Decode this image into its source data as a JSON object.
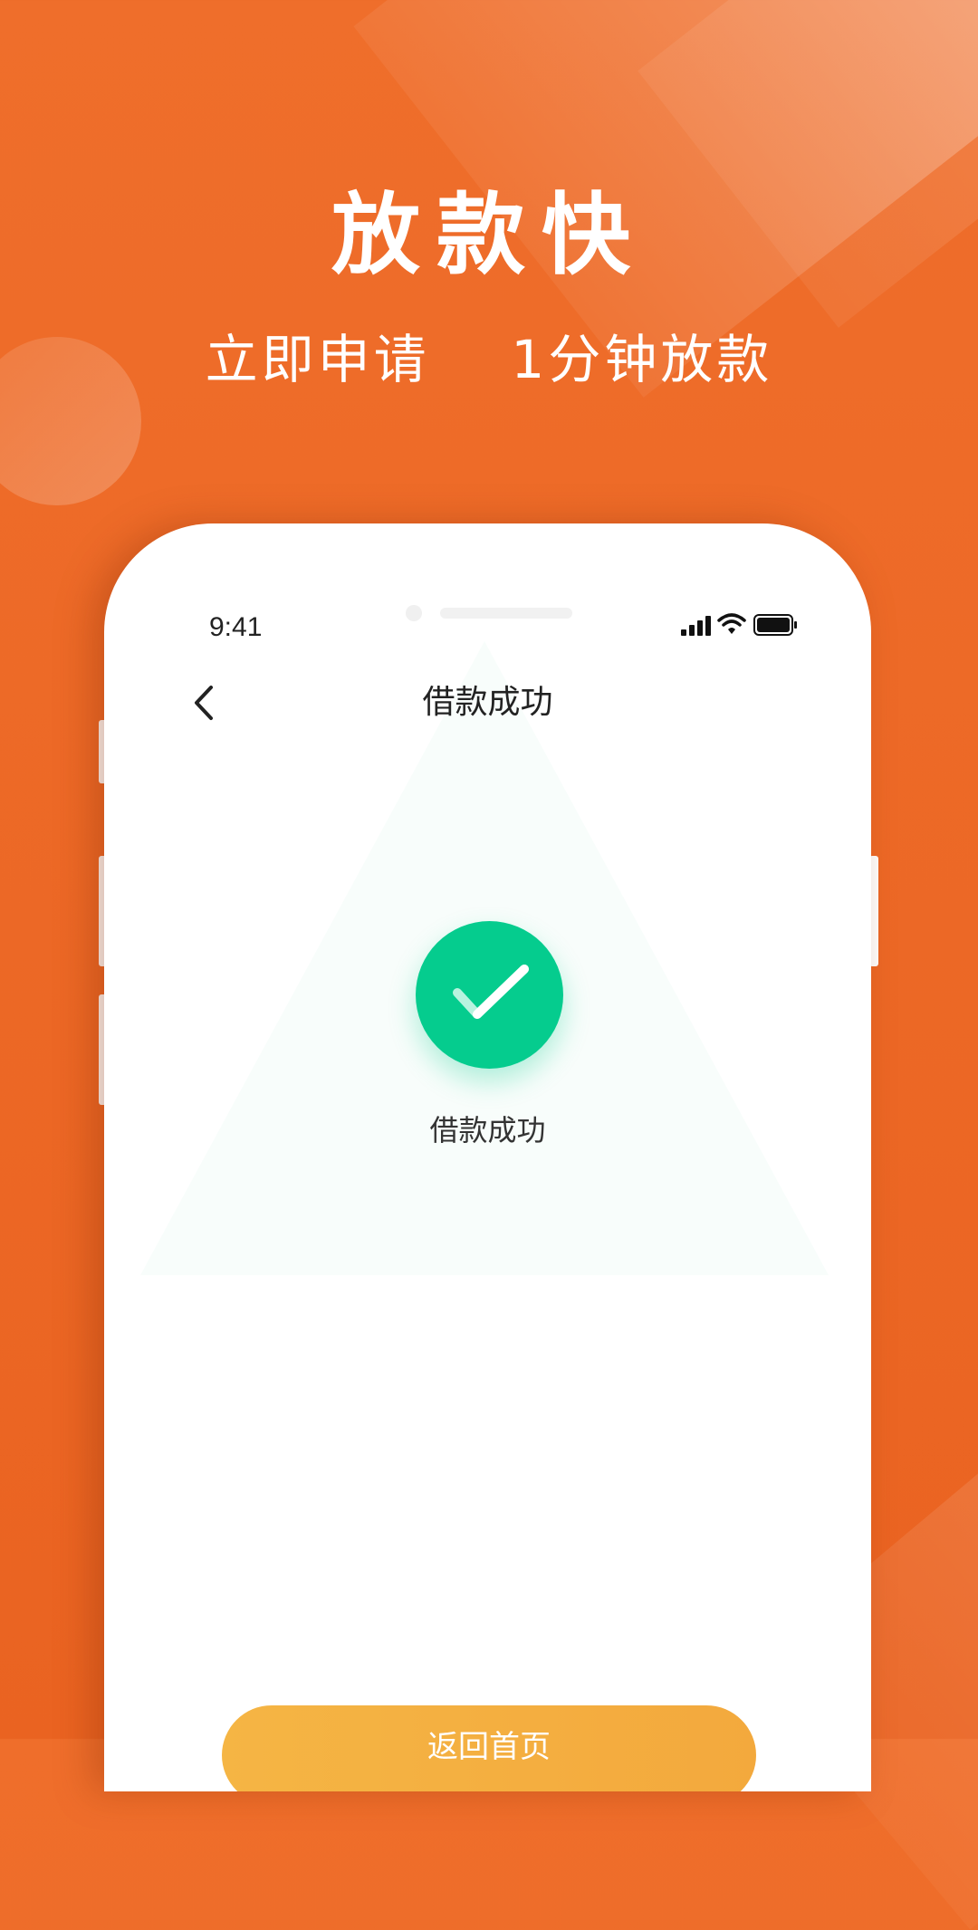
{
  "hero": {
    "title": "放款快",
    "subtitle": "立即申请    1分钟放款"
  },
  "status_bar": {
    "time": "9:41",
    "icons": [
      "signal-icon",
      "wifi-icon",
      "battery-icon"
    ]
  },
  "nav": {
    "back_icon": "chevron-left-icon",
    "title": "借款成功"
  },
  "result": {
    "icon": "check-icon",
    "label": "借款成功"
  },
  "footer": {
    "home_button_label": "返回首页"
  },
  "colors": {
    "background": "#ea6321",
    "success": "#05cc8e",
    "button": "#f3a93d",
    "text_dark": "#222222"
  }
}
